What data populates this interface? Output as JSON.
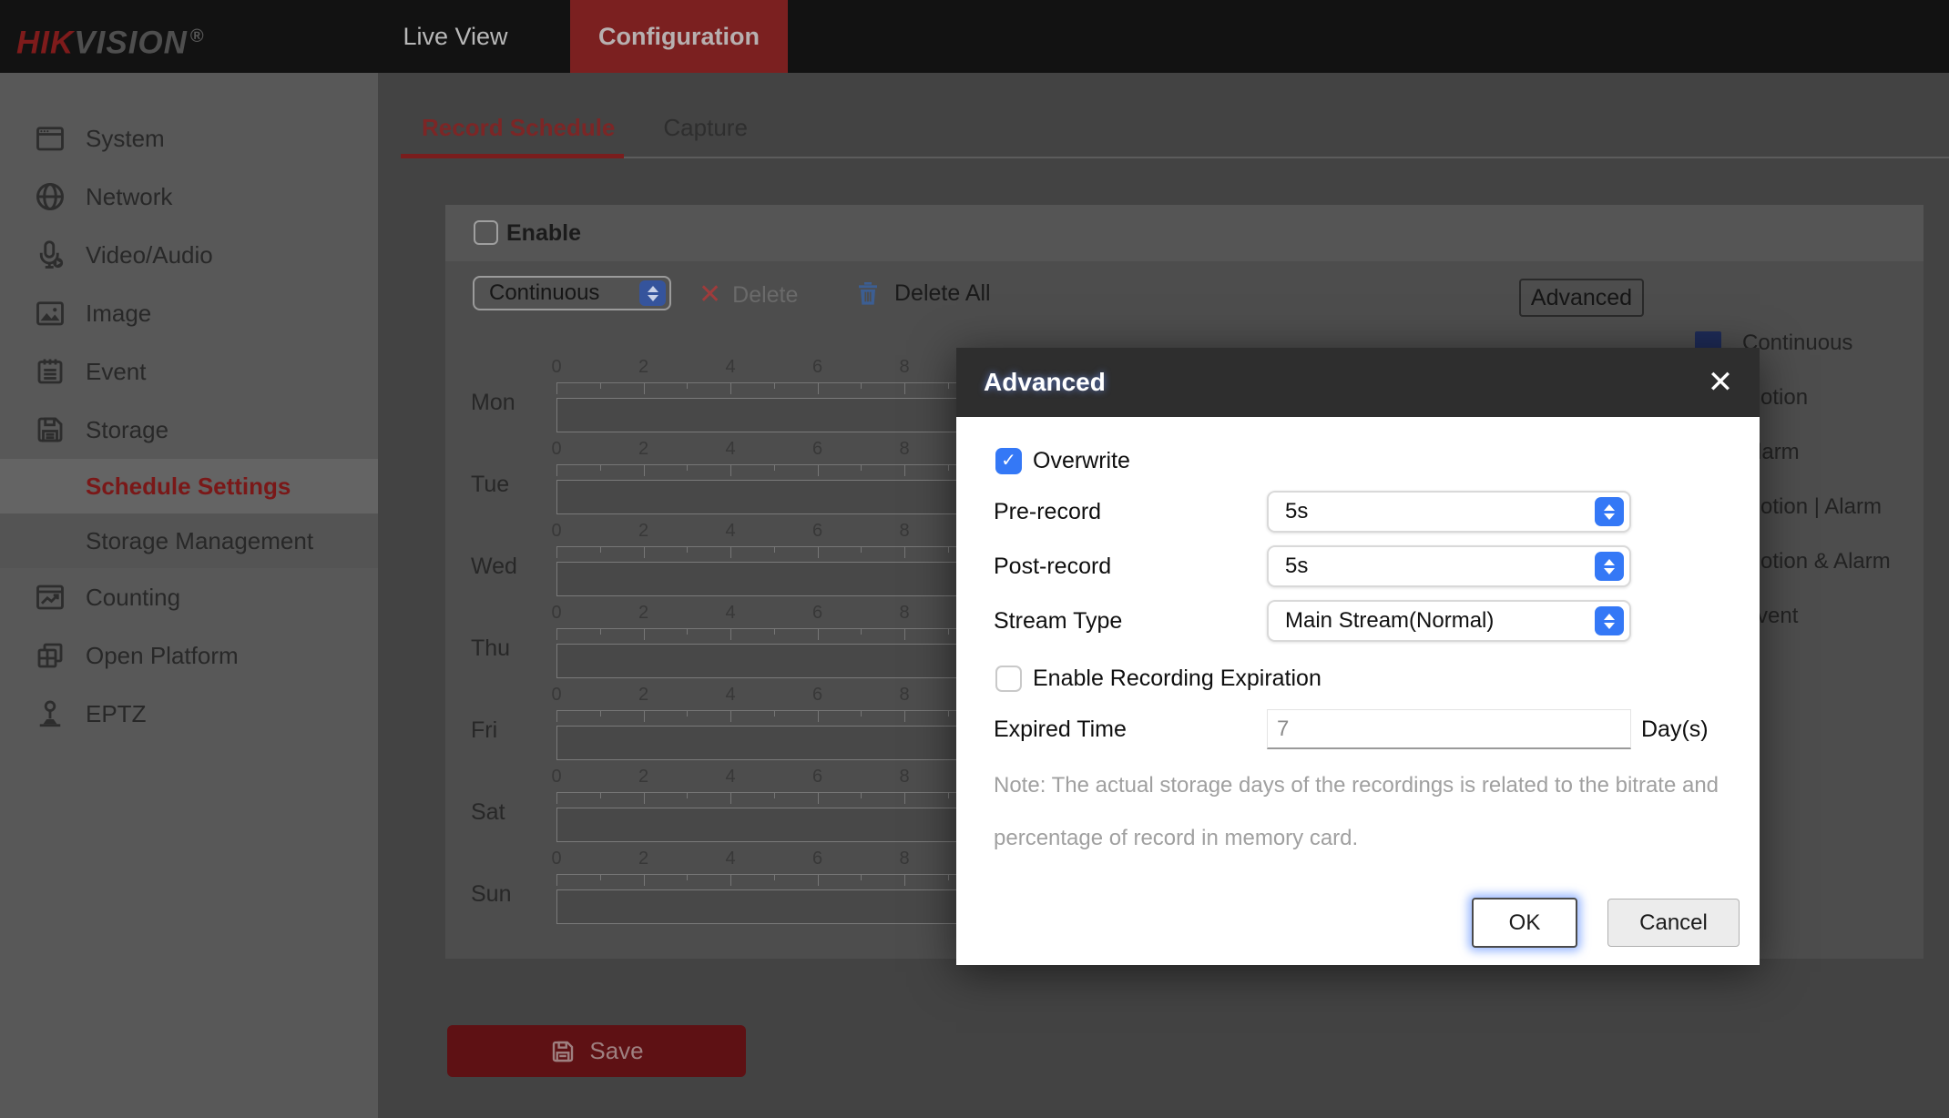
{
  "topbar": {
    "logo": {
      "part1": "HIK",
      "part2": "VISION",
      "registered": "®"
    },
    "tabs": [
      {
        "label": "Live View",
        "active": false
      },
      {
        "label": "Configuration",
        "active": true
      }
    ]
  },
  "sidebar": {
    "items": [
      {
        "id": "system",
        "label": "System",
        "icon": "system",
        "type": "main",
        "active": false
      },
      {
        "id": "network",
        "label": "Network",
        "icon": "network",
        "type": "main",
        "active": false
      },
      {
        "id": "video-audio",
        "label": "Video/Audio",
        "icon": "video-audio",
        "type": "main",
        "active": false
      },
      {
        "id": "image",
        "label": "Image",
        "icon": "image",
        "type": "main",
        "active": false
      },
      {
        "id": "event",
        "label": "Event",
        "icon": "event",
        "type": "main",
        "active": false
      },
      {
        "id": "storage",
        "label": "Storage",
        "icon": "storage",
        "type": "main",
        "active": false
      },
      {
        "id": "schedule-settings",
        "label": "Schedule Settings",
        "icon": "",
        "type": "sub",
        "active": true
      },
      {
        "id": "storage-management",
        "label": "Storage Management",
        "icon": "",
        "type": "sub",
        "active": false
      },
      {
        "id": "counting",
        "label": "Counting",
        "icon": "counting",
        "type": "main",
        "active": false
      },
      {
        "id": "open-platform",
        "label": "Open Platform",
        "icon": "open-platform",
        "type": "main",
        "active": false
      },
      {
        "id": "eptz",
        "label": "EPTZ",
        "icon": "eptz",
        "type": "main",
        "active": false
      }
    ]
  },
  "content": {
    "tabs": [
      {
        "label": "Record Schedule",
        "active": true
      },
      {
        "label": "Capture",
        "active": false
      }
    ],
    "enable_label": "Enable",
    "enable_checked": false,
    "toolbar": {
      "type_select_value": "Continuous",
      "delete_icon": "✕",
      "delete_label": "Delete",
      "delete_enabled": false,
      "delete_all_label": "Delete All",
      "advanced_label": "Advanced"
    },
    "schedule": {
      "days": [
        "Mon",
        "Tue",
        "Wed",
        "Thu",
        "Fri",
        "Sat",
        "Sun"
      ],
      "hour_labels": [
        "0",
        "2",
        "4",
        "6",
        "8"
      ]
    },
    "legend": [
      {
        "label": "Continuous",
        "color": "#1e2b57"
      },
      {
        "label": "Motion",
        "color": "#4a4410"
      },
      {
        "label": "Alarm",
        "color": "#401010"
      },
      {
        "label": "Motion | Alarm",
        "color": "#401b2b"
      },
      {
        "label": "Motion & Alarm",
        "color": "#0e353c"
      },
      {
        "label": "Event",
        "color": "#0e3510"
      }
    ],
    "save_label": "Save"
  },
  "modal": {
    "title": "Advanced",
    "close_icon": "✕",
    "overwrite": {
      "label": "Overwrite",
      "checked": true,
      "check_icon": "✓"
    },
    "fields": [
      {
        "label": "Pre-record",
        "value": "5s"
      },
      {
        "label": "Post-record",
        "value": "5s"
      },
      {
        "label": "Stream Type",
        "value": "Main Stream(Normal)"
      }
    ],
    "expiration": {
      "label": "Enable Recording Expiration",
      "checked": false
    },
    "expired_time": {
      "label": "Expired Time",
      "value": "7",
      "unit": "Day(s)"
    },
    "note_line1": "Note: The actual storage days of the recordings is related to the bitrate and",
    "note_line2": "percentage of record in memory card.",
    "ok_label": "OK",
    "cancel_label": "Cancel"
  },
  "colors": {
    "topbar_bg": "#121212",
    "logo_red": "#7e1b1b",
    "config_tab_bg": "#7b2020",
    "sidebar_bg": "#585858",
    "schedule_red": "#7a1818",
    "main_bg": "#434343",
    "panel_bg": "#4d4d4d",
    "tab_red": "#7c2626",
    "underline_red": "#7a1d1d",
    "save_bg": "#5e1114",
    "modal_blue": "#3478f6",
    "modal_header": "#2e2e2e",
    "legend_continuous": "#1e2b57"
  }
}
